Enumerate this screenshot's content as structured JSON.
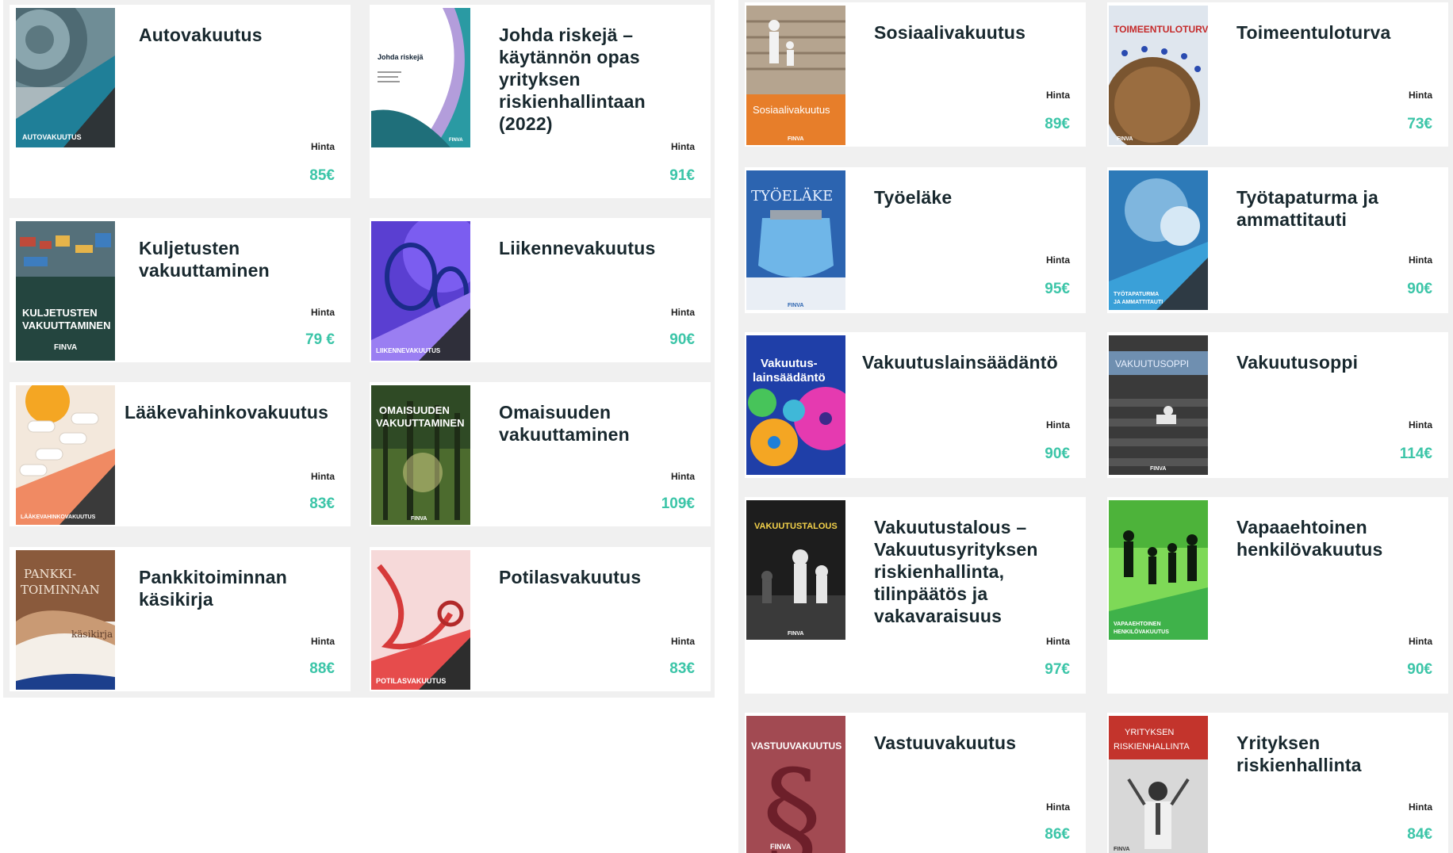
{
  "price_label": "Hinta",
  "publisher": "FINVA",
  "colors": {
    "accent": "#3cc5a8",
    "title": "#18282e",
    "panel": "#f0f0f0"
  },
  "products": [
    {
      "id": "autovakuutus",
      "title": "Autovakuutus",
      "price": "85€",
      "cover_text": "AUTOVAKUUTUS",
      "cover_icon": "car-tire-cover"
    },
    {
      "id": "johda-riskeja",
      "title": "Johda riskejä – käytännön opas yrityksen riskienhallintaan (2022)",
      "price": "91€",
      "cover_text": "Johda riskejä",
      "cover_subtext": "Käytännön opas yrityksen riskienhallintaan",
      "cover_icon": "teal-wave-cover"
    },
    {
      "id": "kuljetusten-vakuuttaminen",
      "title": "Kuljetusten vakuuttaminen",
      "price": "79 €",
      "cover_text": "KULJETUSTEN VAKUUTTAMINEN",
      "cover_icon": "harbor-cover"
    },
    {
      "id": "liikennevakuutus",
      "title": "Liikennevakuutus",
      "price": "90€",
      "cover_text": "LIIKENNEVAKUUTUS",
      "cover_icon": "glasses-cover"
    },
    {
      "id": "laakevahinkovakuutus",
      "title": "Lääkevahinkovakuutus",
      "price": "83€",
      "cover_text": "LÄÄKEVAHINKOVAKUUTUS",
      "cover_icon": "pills-cover"
    },
    {
      "id": "omaisuuden-vakuuttaminen",
      "title": "Omaisuuden vakuuttaminen",
      "price": "109€",
      "cover_text": "OMAISUUDEN VAKUUTTAMINEN",
      "cover_icon": "forest-cover"
    },
    {
      "id": "pankkitoiminnan-kasikirja",
      "title": "Pankkitoiminnan käsikirja",
      "price": "88€",
      "cover_text": "PANKKI-TOIMINNAN",
      "cover_subtext": "käsikirja",
      "cover_icon": "banking-cover"
    },
    {
      "id": "potilasvakuutus",
      "title": "Potilasvakuutus",
      "price": "83€",
      "cover_text": "POTILASVAKUUTUS",
      "cover_icon": "stethoscope-cover"
    },
    {
      "id": "sosiaalivakuutus",
      "title": "Sosiaalivakuutus",
      "price": "89€",
      "cover_text": "Sosiaalivakuutus",
      "cover_icon": "family-cover"
    },
    {
      "id": "toimeentuloturva",
      "title": "Toimeentuloturva",
      "price": "73€",
      "cover_text": "TOIMEENTULOTURVA",
      "cover_icon": "bread-cover"
    },
    {
      "id": "tyoelake",
      "title": "Työeläke",
      "price": "95€",
      "cover_text": "TYÖELÄKE",
      "cover_icon": "purse-cover"
    },
    {
      "id": "tyotapaturma",
      "title": "Työtapaturma ja ammattitauti",
      "price": "90€",
      "cover_text": "TYÖTAPATURMA JA AMMATTITAUTI",
      "cover_icon": "splash-cover"
    },
    {
      "id": "vakuutuslainsaadanto",
      "title": "Vakuutuslainsäädäntö",
      "price": "90€",
      "cover_text": "Vakuutus-lainsäädäntö",
      "cover_icon": "gears-cover"
    },
    {
      "id": "vakuutusoppi",
      "title": "Vakuutusoppi",
      "price": "114€",
      "cover_text": "VAKUUTUSOPPI",
      "cover_icon": "stairs-cover"
    },
    {
      "id": "vakuutustalous",
      "title": "Vakuutustalous – Vakuutusyrityksen riskienhallinta, tilinpäätös ja vakavaraisuus",
      "price": "97€",
      "cover_text": "VAKUUTUSTALOUS",
      "cover_icon": "chess-cover"
    },
    {
      "id": "vapaaehtoinen-henkilovakuutus",
      "title": "Vapaaehtoinen henkilövakuutus",
      "price": "90€",
      "cover_text": "VAPAAEHTOINEN HENKILÖVAKUUTUS",
      "cover_icon": "jumping-family-cover"
    },
    {
      "id": "vastuuvakuutus",
      "title": "Vastuuvakuutus",
      "price": "86€",
      "cover_text": "VASTUUVAKUUTUS",
      "cover_icon": "section-sign-cover"
    },
    {
      "id": "yrityksen-riskienhallinta",
      "title": "Yrityksen riskienhallinta",
      "price": "84€",
      "cover_text": "YRITYKSEN RISKIENHALLINTA",
      "cover_icon": "businessman-cover"
    }
  ]
}
